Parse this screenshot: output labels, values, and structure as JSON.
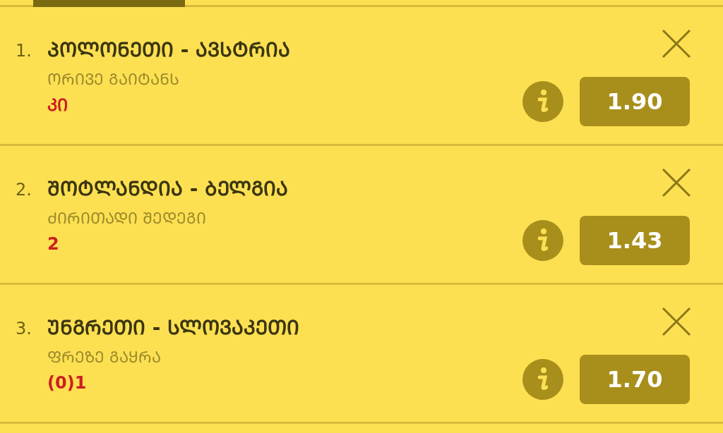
{
  "tabs": [
    {
      "selected": true
    }
  ],
  "bets": [
    {
      "number": "1.",
      "match": "ᲞᲝᲚᲝᲜᲔᲗᲘ - ᲐᲕᲡᲢᲠᲘᲐ",
      "market": "ᲝᲠᲘᲕᲔ ᲒᲐᲘᲢᲐᲜᲡ",
      "pick": "ᲙᲘ",
      "odds": "1.90"
    },
    {
      "number": "2.",
      "match": "ᲨᲝᲢᲚᲐᲜᲓᲘᲐ - ᲑᲔᲚᲒᲘᲐ",
      "market": "ᲫᲘᲠᲘᲗᲐᲓᲘ ᲨᲔᲓᲔᲒᲘ",
      "pick": "2",
      "odds": "1.43"
    },
    {
      "number": "3.",
      "match": "ᲣᲜᲒᲠᲔᲗᲘ - ᲡᲚᲝᲕᲐᲙᲔᲗᲘ",
      "market": "ᲤᲠᲔᲖᲔ ᲒᲐᲧᲠᲐ",
      "pick": "(0)1",
      "odds": "1.70"
    }
  ]
}
